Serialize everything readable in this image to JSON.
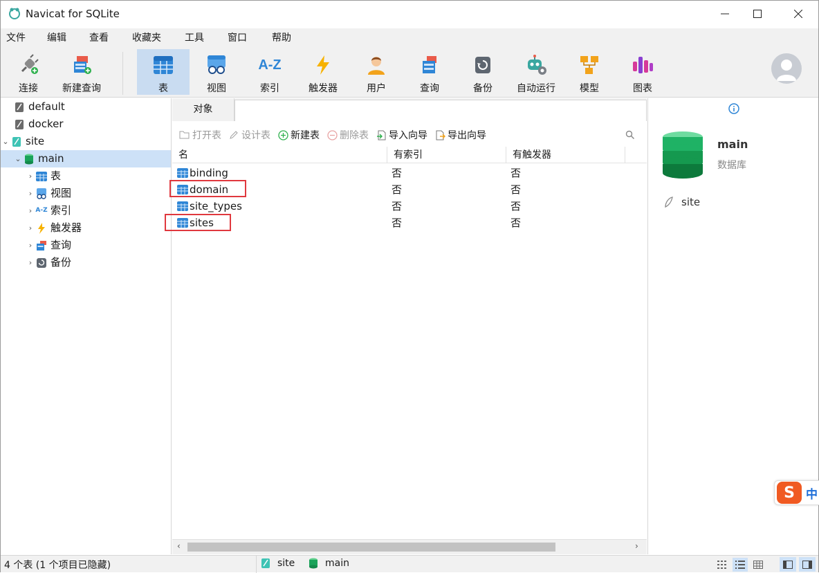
{
  "window": {
    "title": "Navicat for SQLite"
  },
  "menu": [
    "文件",
    "编辑",
    "查看",
    "收藏夹",
    "工具",
    "窗口",
    "帮助"
  ],
  "toolbar": {
    "connect": "连接",
    "new_query": "新建查询",
    "table": "表",
    "view": "视图",
    "index": "索引",
    "index_glyph": "A-Z",
    "trigger": "触发器",
    "user": "用户",
    "query": "查询",
    "backup": "备份",
    "automation": "自动运行",
    "model": "模型",
    "chart": "图表"
  },
  "tree": {
    "connections": [
      "default",
      "docker",
      "site"
    ],
    "database": "main",
    "children": [
      "表",
      "视图",
      "索引",
      "触发器",
      "查询",
      "备份"
    ],
    "index_glyph": "A-Z"
  },
  "tabs": {
    "objects": "对象"
  },
  "object_toolbar": {
    "open_table": "打开表",
    "design_table": "设计表",
    "new_table": "新建表",
    "delete_table": "删除表",
    "import_wizard": "导入向导",
    "export_wizard": "导出向导"
  },
  "grid": {
    "columns": [
      "名",
      "有索引",
      "有触发器"
    ],
    "rows": [
      {
        "name": "binding",
        "has_index": "否",
        "has_trigger": "否"
      },
      {
        "name": "domain",
        "has_index": "否",
        "has_trigger": "否"
      },
      {
        "name": "site_types",
        "has_index": "否",
        "has_trigger": "否"
      },
      {
        "name": "sites",
        "has_index": "否",
        "has_trigger": "否"
      }
    ]
  },
  "info_panel": {
    "name": "main",
    "type": "数据库",
    "connection": "site"
  },
  "ime": {
    "mode": "中",
    "logo": "S"
  },
  "status": {
    "summary": "4 个表 (1 个项目已隐藏)",
    "connection": "site",
    "database": "main"
  },
  "colors": {
    "accent_selected": "#cde1f7",
    "highlight_red": "#e0383e",
    "db_green": "#1aa35a"
  }
}
